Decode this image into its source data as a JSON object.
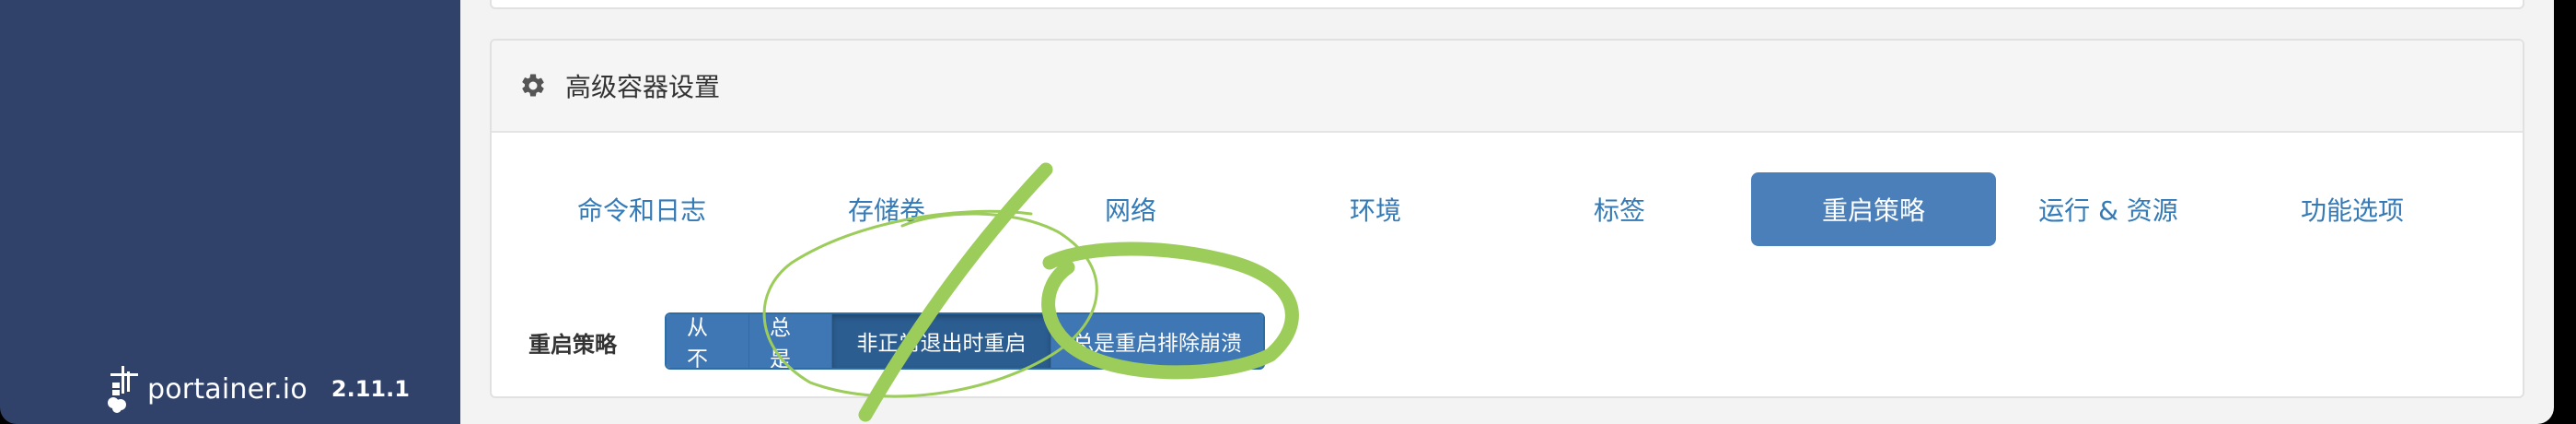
{
  "sidebar": {
    "brand_name": "portainer.io",
    "version": "2.11.1"
  },
  "panel": {
    "title": "高级容器设置"
  },
  "tabs": [
    {
      "label": "命令和日志",
      "active": false
    },
    {
      "label": "存储卷",
      "active": false
    },
    {
      "label": "网络",
      "active": false
    },
    {
      "label": "环境",
      "active": false
    },
    {
      "label": "标签",
      "active": false
    },
    {
      "label": "重启策略",
      "active": true
    },
    {
      "label": "运行 & 资源",
      "active": false
    },
    {
      "label": "功能选项",
      "active": false
    }
  ],
  "restart_policy": {
    "label": "重启策略",
    "options": [
      "从不",
      "总是",
      "非正常退出时重启",
      "总是重启排除崩溃"
    ],
    "selected": "非正常退出时重启"
  },
  "colors": {
    "sidebar_bg": "#30426a",
    "accent": "#337ab7",
    "active_tab_bg": "#4b7fba",
    "annotation_green": "#9ccc5a"
  },
  "icons": [
    "portainer-logo-icon",
    "gear-icon"
  ]
}
